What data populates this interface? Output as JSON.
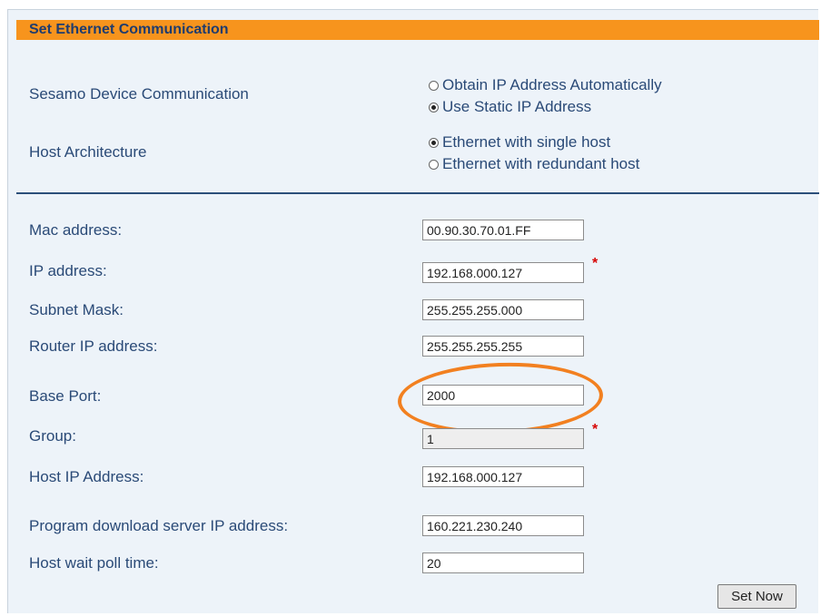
{
  "section": {
    "title": "Set Ethernet Communication"
  },
  "comm": {
    "label": "Sesamo Device Communication",
    "options": [
      "Obtain IP Address Automatically",
      "Use Static IP Address"
    ],
    "selected": "Use Static IP Address"
  },
  "host_arch": {
    "label": "Host Architecture",
    "options": [
      "Ethernet with single host",
      "Ethernet with redundant host"
    ],
    "selected": "Ethernet with single host"
  },
  "fields": [
    {
      "label": "Mac address:",
      "value": "00.90.30.70.01.FF",
      "required": false
    },
    {
      "label": "IP address:",
      "value": "192.168.000.127",
      "required": true,
      "marker": "*"
    },
    {
      "label": "Subnet Mask:",
      "value": "255.255.255.000",
      "required": false
    },
    {
      "label": "Router IP address:",
      "value": "255.255.255.255",
      "required": false
    },
    {
      "label": "Base Port:",
      "value": "2000",
      "required": false
    },
    {
      "label": "Group:",
      "value": "1",
      "required": true,
      "disabled": true,
      "marker": "*"
    },
    {
      "label": "Host IP Address:",
      "value": "192.168.000.127",
      "required": false
    },
    {
      "label": "Program download server IP address:",
      "value": "160.221.230.240",
      "required": false
    },
    {
      "label": "Host wait poll time:",
      "value": "20",
      "required": false
    }
  ],
  "actions": {
    "set_now": "Set Now"
  },
  "colors": {
    "header": "#f7941d",
    "label_text": "#2a4a77",
    "highlight": "#f28020",
    "required": "#d60000"
  }
}
